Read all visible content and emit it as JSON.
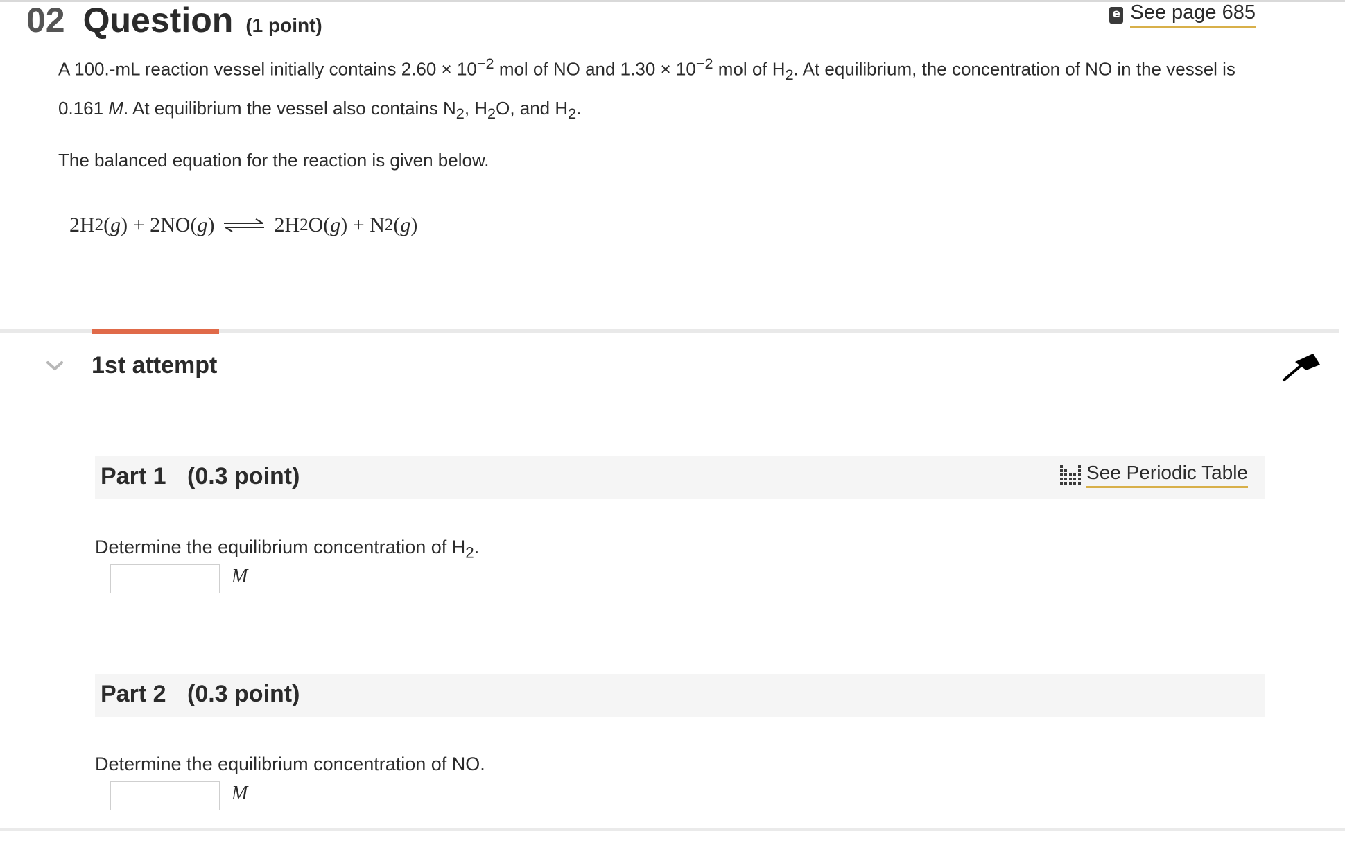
{
  "question": {
    "number": "02",
    "title": "Question",
    "points": "(1 point)",
    "see_page": "See page 685",
    "ebook_icon": "ebook-icon"
  },
  "problem": {
    "s1": "A 100.-mL reaction vessel initially contains 2.60 × 10",
    "exp1": "−2",
    "s2": " mol of NO and 1.30 × 10",
    "exp2": "−2",
    "s3": " mol of H",
    "sub1": "2",
    "s4": ". At equilibrium, the concentration of NO in the vessel is 0.161 ",
    "unit_m": "M",
    "s5": ". At equilibrium the vessel also contains N",
    "sub2": "2",
    "s6": ", H",
    "sub3": "2",
    "s7": "O, and H",
    "sub4": "2",
    "s8": ".",
    "balanced_intro": "The balanced equation for the reaction is given below."
  },
  "equation": {
    "r1_coef": "2H",
    "r1_sub": "2",
    "r1_state": "(",
    "r1_g": "g",
    "r1_close": ")",
    "plus1": " + ",
    "r2": "2NO",
    "r2_open": "(",
    "r2_g": "g",
    "r2_close": ")",
    "p1_coef": "2H",
    "p1_sub": "2",
    "p1_rest": "O",
    "p1_open": "(",
    "p1_g": "g",
    "p1_close": ")",
    "plus2": " + ",
    "p2": "N",
    "p2_sub": "2",
    "p2_open": "(",
    "p2_g": "g",
    "p2_close": ")"
  },
  "attempt": {
    "title": "1st attempt",
    "accent_color": "#e06a49",
    "collapse_icon": "chevron-down-icon",
    "pin_icon": "pin-icon"
  },
  "parts": [
    {
      "label": "Part 1",
      "points": "(0.3 point)",
      "prompt_pre": "Determine the equilibrium concentration of H",
      "prompt_sub": "2",
      "prompt_post": ".",
      "answer_value": "",
      "unit": "M",
      "periodic_label": "See Periodic Table",
      "periodic_icon": "periodic-table-icon"
    },
    {
      "label": "Part 2",
      "points": "(0.3 point)",
      "prompt_pre": "Determine the equilibrium concentration of NO.",
      "answer_value": "",
      "unit": "M"
    }
  ]
}
